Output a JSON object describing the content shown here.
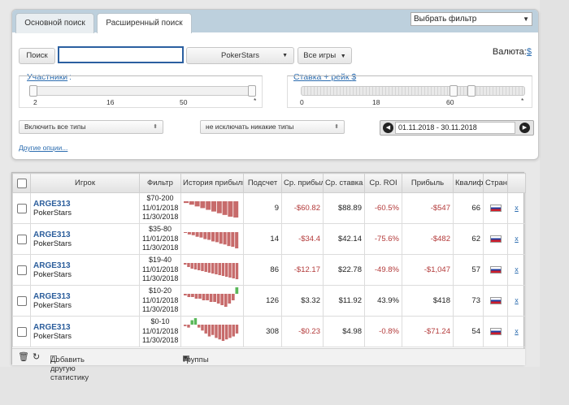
{
  "tabs": [
    {
      "label": "Основной поиск"
    },
    {
      "label": "Расширенный поиск"
    }
  ],
  "filter_select": {
    "label": "Выбрать фильтр"
  },
  "search": {
    "button_label": "Поиск",
    "value": "",
    "placeholder": ""
  },
  "site_select": {
    "value": "PokerStars"
  },
  "games_select": {
    "value": "Все игры"
  },
  "currency": {
    "label": "Валюта:",
    "value": "$"
  },
  "participants": {
    "label": "Участники",
    "colon": ":",
    "ticks": [
      "2",
      "16",
      "50",
      "*"
    ],
    "range": [
      0,
      1
    ]
  },
  "stake": {
    "label": "Ставка + рейк",
    "currency": "$",
    "ticks": [
      "0",
      "18",
      "60",
      "*"
    ],
    "range": [
      0.68,
      0.76
    ]
  },
  "type_include": {
    "value": "Включить все типы"
  },
  "type_exclude": {
    "value": "не исключать никакие типы"
  },
  "date_range": {
    "value": "01.11.2018 - 30.11.2018"
  },
  "more_options": {
    "label": "Другие опции..."
  },
  "table": {
    "headers": [
      "Игрок",
      "Фильтр",
      "История прибыли",
      "Подсчет",
      "Ср. прибыль",
      "Ср. ставка",
      "Ср. ROI",
      "Прибыль",
      "Квалиф.",
      "Страна"
    ],
    "rows": [
      {
        "name": "ARGE313",
        "site": "PokerStars",
        "filter": [
          "$70-200",
          "11/01/2018",
          "11/30/2018"
        ],
        "count": "9",
        "avg_profit": "-$60.82",
        "avg_stake": "$88.89",
        "avg_roi": "-60.5%",
        "profit": "-$547",
        "qual": "66",
        "history": [
          -2,
          -4,
          -6,
          -8,
          -10,
          -12,
          -14,
          -16,
          -18,
          -19
        ],
        "delete": "x"
      },
      {
        "name": "ARGE313",
        "site": "PokerStars",
        "filter": [
          "$35-80",
          "11/01/2018",
          "11/30/2018"
        ],
        "count": "14",
        "avg_profit": "-$34.4",
        "avg_stake": "$42.14",
        "avg_roi": "-75.6%",
        "profit": "-$482",
        "qual": "62",
        "history": [
          -1,
          -3,
          -4,
          -6,
          -7,
          -9,
          -10,
          -12,
          -13,
          -15,
          -16,
          -18,
          -19,
          -21
        ],
        "delete": "x"
      },
      {
        "name": "ARGE313",
        "site": "PokerStars",
        "filter": [
          "$19-40",
          "11/01/2018",
          "11/30/2018"
        ],
        "count": "86",
        "avg_profit": "-$12.17",
        "avg_stake": "$22.78",
        "avg_roi": "-49.8%",
        "profit": "-$1,047",
        "qual": "57",
        "history": [
          -2,
          -5,
          -7,
          -8,
          -9,
          -10,
          -11,
          -12,
          -13,
          -14,
          -15,
          -16,
          -17,
          -18,
          -19,
          -20
        ],
        "delete": "x"
      },
      {
        "name": "ARGE313",
        "site": "PokerStars",
        "filter": [
          "$10-20",
          "11/01/2018",
          "11/30/2018"
        ],
        "count": "126",
        "avg_profit": "$3.32",
        "avg_stake": "$11.92",
        "avg_roi": "43.9%",
        "profit": "$418",
        "qual": "73",
        "history": [
          -1,
          -2,
          -2,
          -3,
          -3,
          -4,
          -4,
          -5,
          -5,
          -6,
          -7,
          -8,
          -6,
          -4,
          10
        ],
        "delete": "x"
      },
      {
        "name": "ARGE313",
        "site": "PokerStars",
        "filter": [
          "$0-10",
          "11/01/2018",
          "11/30/2018"
        ],
        "count": "308",
        "avg_profit": "-$0.23",
        "avg_stake": "$4.98",
        "avg_roi": "-0.8%",
        "profit": "-$71.24",
        "qual": "54",
        "history": [
          -1,
          -2,
          3,
          5,
          -2,
          -4,
          -6,
          -8,
          -7,
          -9,
          -10,
          -11,
          -10,
          -9,
          -8,
          -6
        ],
        "delete": "x"
      }
    ]
  },
  "footer": {
    "add_stat": "Добавить другую статистику",
    "groups": "Группы"
  },
  "colors": {
    "accent": "#2c6db0",
    "negative_bar": "#c76b6b",
    "positive_bar": "#5ab85a",
    "tabbar": "#bdd0dd"
  }
}
